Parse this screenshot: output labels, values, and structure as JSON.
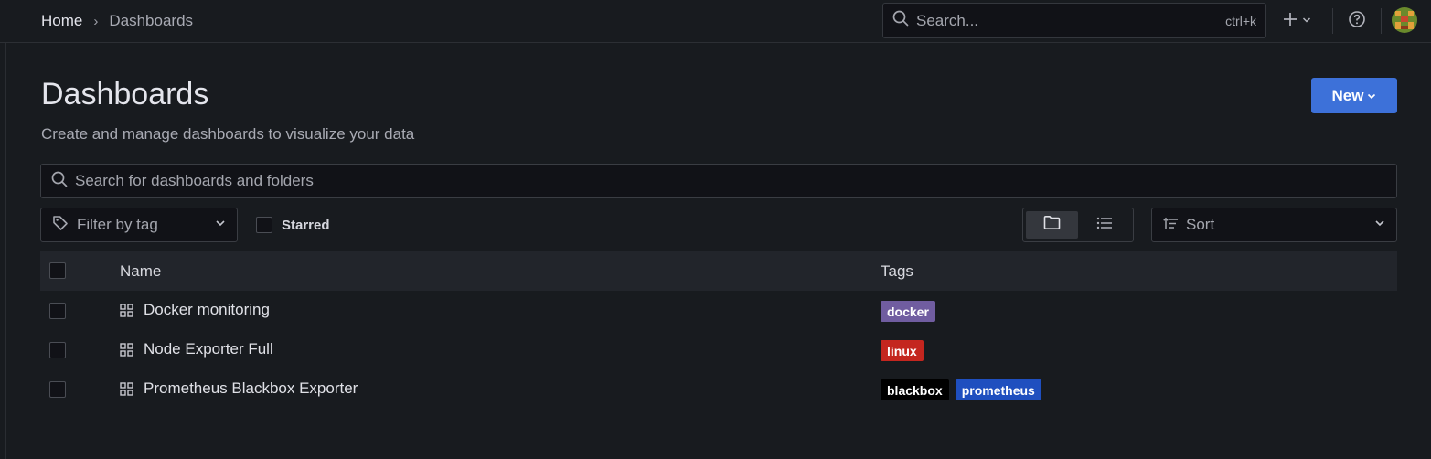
{
  "breadcrumb": {
    "home": "Home",
    "separator": "›",
    "current": "Dashboards"
  },
  "top_search": {
    "placeholder": "Search...",
    "shortcut": "ctrl+k"
  },
  "header": {
    "title": "Dashboards",
    "subtitle": "Create and manage dashboards to visualize your data",
    "new_button": "New"
  },
  "search": {
    "placeholder": "Search for dashboards and folders"
  },
  "filters": {
    "tag_filter_placeholder": "Filter by tag",
    "starred_label": "Starred",
    "sort_placeholder": "Sort",
    "view_mode": "folder"
  },
  "table": {
    "columns": {
      "name": "Name",
      "tags": "Tags"
    },
    "rows": [
      {
        "title": "Docker monitoring",
        "tags": [
          {
            "label": "docker",
            "color": "#705da0"
          }
        ]
      },
      {
        "title": "Node Exporter Full",
        "tags": [
          {
            "label": "linux",
            "color": "#c4261f"
          }
        ]
      },
      {
        "title": "Prometheus Blackbox Exporter",
        "tags": [
          {
            "label": "blackbox",
            "color": "#000000"
          },
          {
            "label": "prometheus",
            "color": "#1f4fbf"
          }
        ]
      }
    ]
  },
  "colors": {
    "accent": "#3d71d9",
    "background": "#181b1f"
  },
  "icons": [
    "search-icon",
    "plus-icon",
    "help-icon",
    "tag-icon",
    "folder-view-icon",
    "list-view-icon",
    "sort-icon",
    "dashboard-grid-icon"
  ]
}
